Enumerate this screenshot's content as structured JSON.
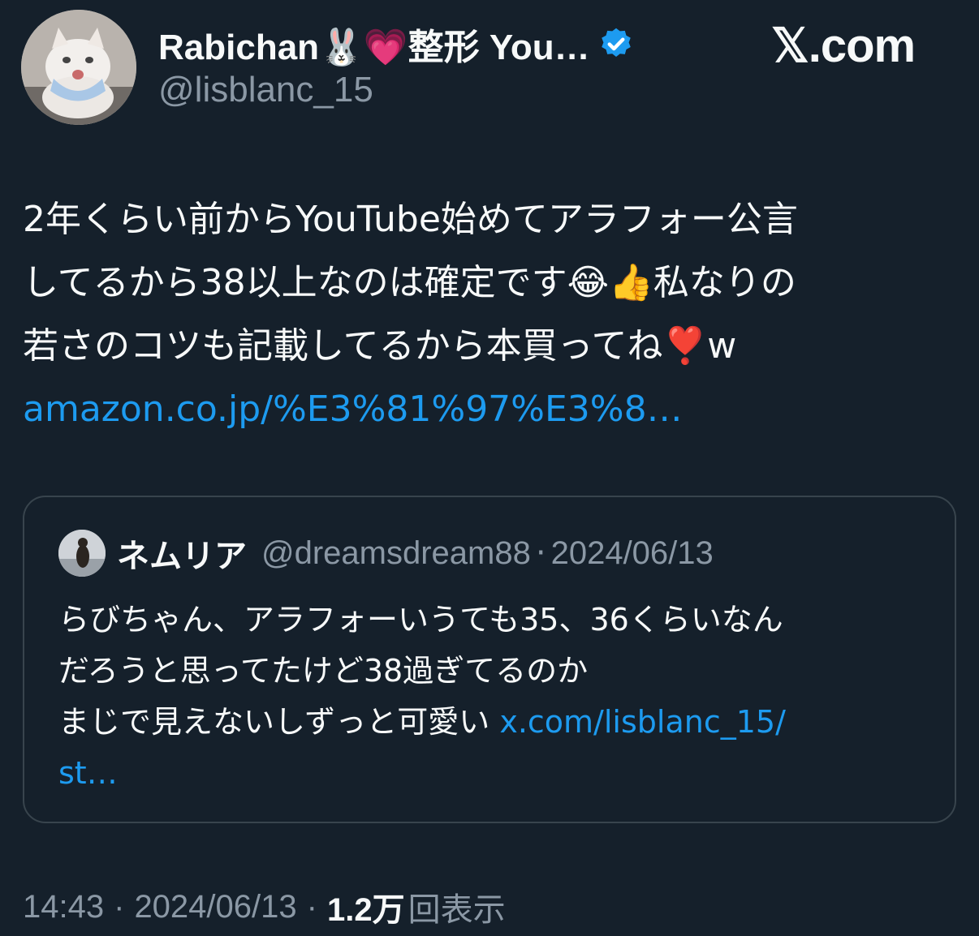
{
  "author": {
    "display_name": "Rabichan🐰💗整形 You…",
    "handle": "@lisblanc_15",
    "verified": true,
    "avatar_icon": "white-cat-avatar"
  },
  "site_logo": "𝕏.com",
  "tweet": {
    "lines": [
      "2年くらい前からYouTube始めてアラフォー公言",
      "してるから38以上なのは確定です😂👍私なりの",
      "若さのコツも記載してるから本買ってね❣️w"
    ],
    "link": "amazon.co.jp/%E3%81%97%E3%8…"
  },
  "quote": {
    "name": "ネムリア",
    "handle": "@dreamsdream88",
    "separator": "·",
    "date": "2024/06/13",
    "lines": [
      "らびちゃん、アラフォーいうても35、36くらいなん",
      "だろうと思ってたけど38過ぎてるのか"
    ],
    "line3_text": "まじで見えないしずっと可愛い ",
    "link_part1": "x.com/lisblanc_15/",
    "link_part2": "st…"
  },
  "footer": {
    "time": "14:43",
    "separator": "·",
    "date": "2024/06/13",
    "views_count": "1.2万",
    "views_label": "回表示"
  },
  "colors": {
    "background": "#15202b",
    "text": "#f7f9f9",
    "muted": "#8b98a5",
    "link": "#1d9bf0",
    "border": "#38444d",
    "verified": "#1d9bf0"
  }
}
